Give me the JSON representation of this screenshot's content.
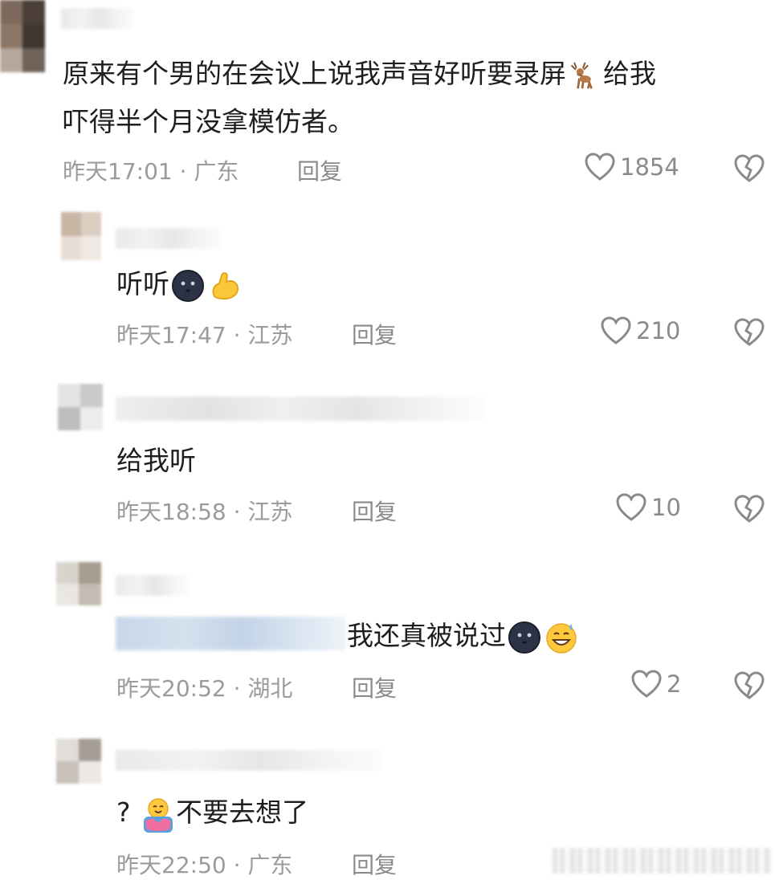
{
  "comments": [
    {
      "text_lines": [
        "原来有个男的在会议上说我声音好听要录屏",
        "给我",
        "吓得半个月没拿模仿者。"
      ],
      "time": "昨天17:01",
      "location": "广东",
      "reply_label": "回复",
      "likes": "1854"
    },
    {
      "text": "听听",
      "time": "昨天17:47",
      "location": "江苏",
      "reply_label": "回复",
      "likes": "210"
    },
    {
      "text": "给我听",
      "time": "昨天18:58",
      "location": "江苏",
      "reply_label": "回复",
      "likes": "10"
    },
    {
      "text": "我还真被说过",
      "time": "昨天20:52",
      "location": "湖北",
      "reply_label": "回复",
      "likes": "2"
    },
    {
      "text_prefix": "?",
      "text": "不要去想了",
      "time": "昨天22:50",
      "location": "广东",
      "reply_label": "回复"
    }
  ],
  "separator": "·",
  "icons": {
    "like": "heart-outline-icon",
    "dislike": "broken-heart-icon",
    "emoji_1": "deer-emoji",
    "emoji_2": "black-moon-face-emoji",
    "emoji_3": "flexed-biceps-emoji",
    "emoji_4": "grinning-sweat-emoji",
    "emoji_5": "hugging-emoji"
  },
  "colors": {
    "text": "#1e1e1e",
    "meta": "#9b9b9b",
    "icon": "#8a8a8a"
  }
}
